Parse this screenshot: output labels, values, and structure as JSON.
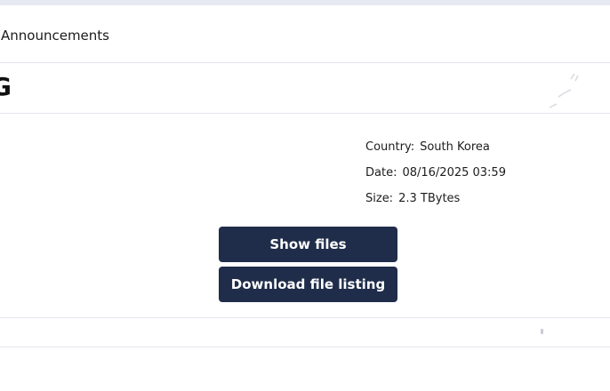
{
  "nav": {
    "announcements_label": "Announcements"
  },
  "header": {
    "title": "G"
  },
  "details": {
    "country_label": "Country:",
    "country_value": "South Korea",
    "date_label": "Date:",
    "date_value": "08/16/2025 03:59",
    "size_label": "Size:",
    "size_value": "2.3 TBytes"
  },
  "actions": {
    "show_files_label": "Show files",
    "download_listing_label": "Download file listing"
  },
  "colors": {
    "button_bg": "#1f2d4a",
    "button_text": "#ffffff",
    "page_bg": "#ffffff"
  }
}
